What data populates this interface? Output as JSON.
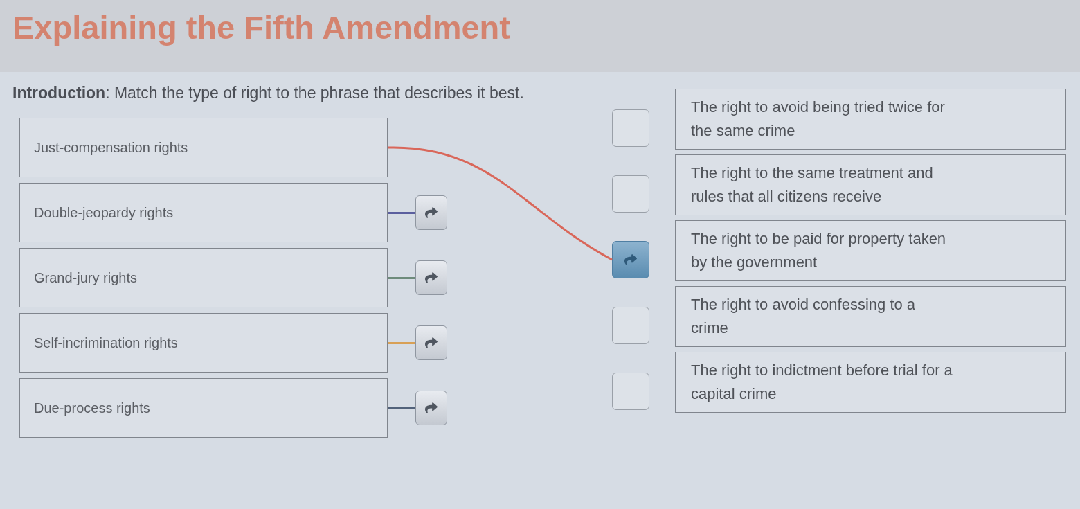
{
  "title": "Explaining the Fifth Amendment",
  "instruction": "**Introduction**: Match the type of right to the phrase that describes it best.",
  "left_items": [
    {
      "label": "Just-compensation rights",
      "linked": true,
      "color": "#d9675a"
    },
    {
      "label": "Double-jeopardy rights",
      "linked": false,
      "color": "#5b5f9e"
    },
    {
      "label": "Grand-jury rights",
      "linked": false,
      "color": "#6e8b7b"
    },
    {
      "label": "Self-incrimination rights",
      "linked": false,
      "color": "#d8a055"
    },
    {
      "label": "Due-process rights",
      "linked": false,
      "color": "#52627a"
    }
  ],
  "right_items": [
    {
      "lines": [
        "The right to avoid being tried twice for",
        "the same crime"
      ],
      "linked": false
    },
    {
      "lines": [
        "The right to the same treatment and",
        "rules that all citizens receive"
      ],
      "linked": false
    },
    {
      "lines": [
        "The right to be paid for property taken",
        "by the government"
      ],
      "linked": true
    },
    {
      "lines": [
        "The right to avoid confessing to a",
        "crime"
      ],
      "linked": false
    },
    {
      "lines": [
        "The right to indictment before trial for a",
        "capital crime"
      ],
      "linked": false
    }
  ]
}
